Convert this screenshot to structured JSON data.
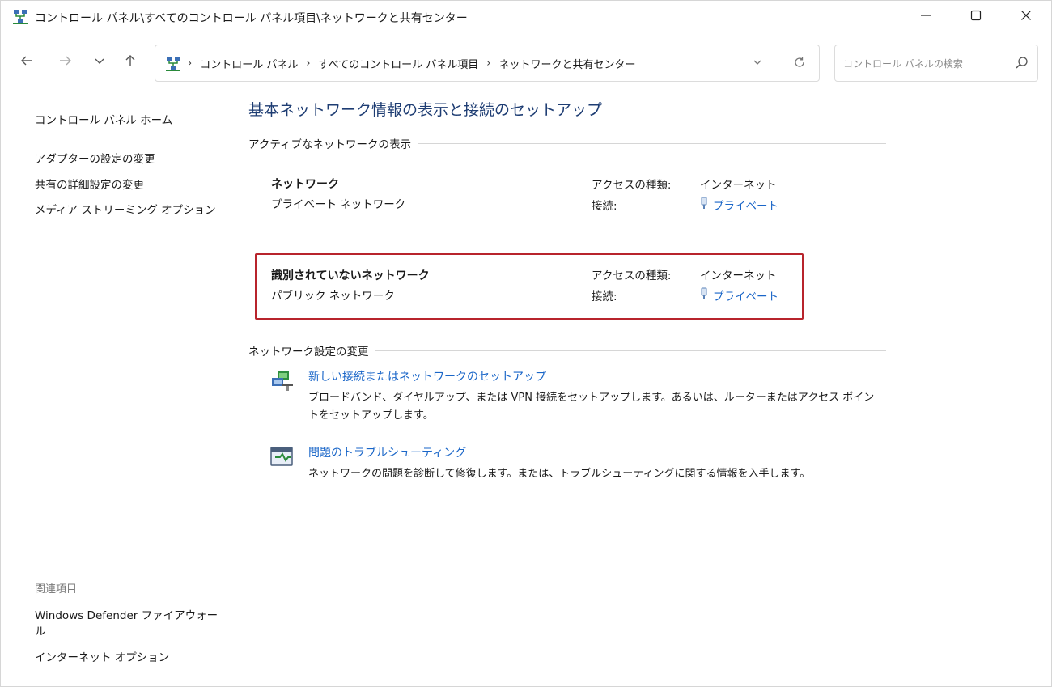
{
  "window": {
    "title": "コントロール パネル\\すべてのコントロール パネル項目\\ネットワークと共有センター"
  },
  "address": {
    "crumbs": [
      "コントロール パネル",
      "すべてのコントロール パネル項目",
      "ネットワークと共有センター"
    ],
    "separator": "›"
  },
  "search": {
    "placeholder": "コントロール パネルの検索"
  },
  "leftpane": {
    "home": "コントロール パネル ホーム",
    "links": [
      "アダプターの設定の変更",
      "共有の詳細設定の変更",
      "メディア ストリーミング オプション"
    ],
    "related_title": "関連項目",
    "related": [
      "Windows Defender ファイアウォール",
      "インターネット オプション"
    ]
  },
  "main": {
    "title": "基本ネットワーク情報の表示と接続のセットアップ",
    "active_section": "アクティブなネットワークの表示",
    "networks": [
      {
        "name": "ネットワーク",
        "type": "プライベート ネットワーク",
        "access_label": "アクセスの種類:",
        "access_value": "インターネット",
        "connection_label": "接続:",
        "connection_value": "プライベート"
      },
      {
        "name": "識別されていないネットワーク",
        "type": "パブリック ネットワーク",
        "access_label": "アクセスの種類:",
        "access_value": "インターネット",
        "connection_label": "接続:",
        "connection_value": "プライベート"
      }
    ],
    "change_section": "ネットワーク設定の変更",
    "tasks": [
      {
        "link": "新しい接続またはネットワークのセットアップ",
        "desc": "ブロードバンド、ダイヤルアップ、または VPN 接続をセットアップします。あるいは、ルーターまたはアクセス ポイントをセットアップします。"
      },
      {
        "link": "問題のトラブルシューティング",
        "desc": "ネットワークの問題を診断して修復します。または、トラブルシューティングに関する情報を入手します。"
      }
    ]
  },
  "colors": {
    "link": "#1a66c8",
    "title": "#1e3d73",
    "highlight": "#b8242c"
  },
  "icons": [
    "network-center-icon",
    "minimize-icon",
    "maximize-icon",
    "close-icon",
    "back-arrow-icon",
    "forward-arrow-icon",
    "recent-chevron-icon",
    "up-arrow-icon",
    "refresh-icon",
    "search-icon",
    "connection-plug-icon",
    "new-connection-icon",
    "troubleshoot-icon"
  ]
}
